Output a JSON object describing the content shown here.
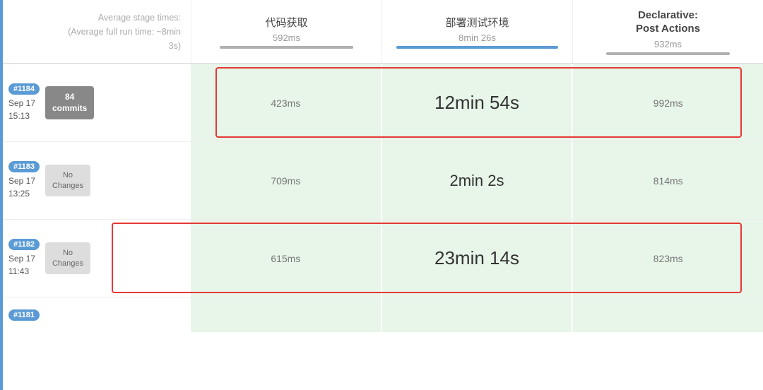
{
  "header": {
    "avg_label": "Average stage times:",
    "avg_full_label": "(Average full run time: ~8min",
    "avg_suffix": "3s)",
    "columns": [
      {
        "label": "代码获取",
        "avg": "592ms",
        "bar_color": "#aaa",
        "bar_width": "60%"
      },
      {
        "label": "部署测试环境",
        "avg": "8min 26s",
        "bar_color": "#5b9bd5",
        "bar_width": "90%"
      },
      {
        "label": "Declarative:\nPost Actions",
        "avg": "932ms",
        "bar_color": "#aaa",
        "bar_width": "65%"
      }
    ]
  },
  "runs": [
    {
      "id": "#1184",
      "date": "Sep 17",
      "time": "15:13",
      "commits_label": "84\ncommits",
      "has_commits": true,
      "cells": [
        "423ms",
        "12min 54s",
        "992ms"
      ],
      "large_cell": 1,
      "highlight": true
    },
    {
      "id": "#1183",
      "date": "Sep 17",
      "time": "13:25",
      "no_changes": "No\nChanges",
      "has_commits": false,
      "cells": [
        "709ms",
        "2min 2s",
        "814ms"
      ],
      "large_cell": 1,
      "highlight": false
    },
    {
      "id": "#1182",
      "date": "Sep 17",
      "time": "11:43",
      "no_changes": "No\nChanges",
      "has_commits": false,
      "cells": [
        "615ms",
        "23min 14s",
        "823ms"
      ],
      "large_cell": 1,
      "highlight": true
    },
    {
      "id": "#1181",
      "date": "",
      "time": "",
      "partial": true
    }
  ],
  "colors": {
    "highlight_border": "#e53935",
    "badge_blue": "#5b9bd5",
    "commits_gray": "#888888",
    "no_changes_bg": "#e0e0e0",
    "cell_green": "#e8f5e9",
    "bar_blue": "#5b9bd5",
    "bar_gray": "#b0b0b0"
  }
}
